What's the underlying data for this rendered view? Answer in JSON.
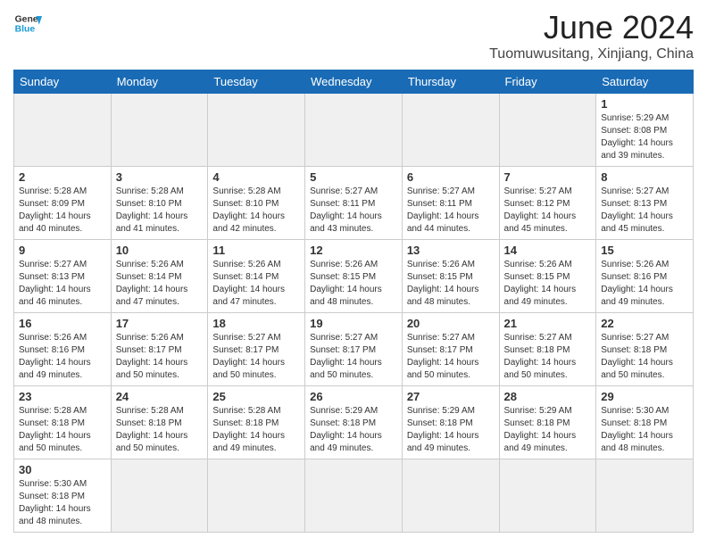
{
  "header": {
    "logo_general": "General",
    "logo_blue": "Blue",
    "month_title": "June 2024",
    "location": "Tuomuwusitang, Xinjiang, China"
  },
  "days_of_week": [
    "Sunday",
    "Monday",
    "Tuesday",
    "Wednesday",
    "Thursday",
    "Friday",
    "Saturday"
  ],
  "weeks": [
    [
      {
        "day": "",
        "empty": true
      },
      {
        "day": "",
        "empty": true
      },
      {
        "day": "",
        "empty": true
      },
      {
        "day": "",
        "empty": true
      },
      {
        "day": "",
        "empty": true
      },
      {
        "day": "",
        "empty": true
      },
      {
        "day": "1",
        "sunrise": "5:29 AM",
        "sunset": "8:08 PM",
        "daylight": "14 hours and 39 minutes."
      }
    ],
    [
      {
        "day": "2",
        "sunrise": "5:28 AM",
        "sunset": "8:09 PM",
        "daylight": "14 hours and 40 minutes."
      },
      {
        "day": "3",
        "sunrise": "5:28 AM",
        "sunset": "8:10 PM",
        "daylight": "14 hours and 41 minutes."
      },
      {
        "day": "4",
        "sunrise": "5:28 AM",
        "sunset": "8:10 PM",
        "daylight": "14 hours and 42 minutes."
      },
      {
        "day": "5",
        "sunrise": "5:27 AM",
        "sunset": "8:11 PM",
        "daylight": "14 hours and 43 minutes."
      },
      {
        "day": "6",
        "sunrise": "5:27 AM",
        "sunset": "8:11 PM",
        "daylight": "14 hours and 44 minutes."
      },
      {
        "day": "7",
        "sunrise": "5:27 AM",
        "sunset": "8:12 PM",
        "daylight": "14 hours and 45 minutes."
      },
      {
        "day": "8",
        "sunrise": "5:27 AM",
        "sunset": "8:13 PM",
        "daylight": "14 hours and 45 minutes."
      }
    ],
    [
      {
        "day": "9",
        "sunrise": "5:27 AM",
        "sunset": "8:13 PM",
        "daylight": "14 hours and 46 minutes."
      },
      {
        "day": "10",
        "sunrise": "5:26 AM",
        "sunset": "8:14 PM",
        "daylight": "14 hours and 47 minutes."
      },
      {
        "day": "11",
        "sunrise": "5:26 AM",
        "sunset": "8:14 PM",
        "daylight": "14 hours and 47 minutes."
      },
      {
        "day": "12",
        "sunrise": "5:26 AM",
        "sunset": "8:15 PM",
        "daylight": "14 hours and 48 minutes."
      },
      {
        "day": "13",
        "sunrise": "5:26 AM",
        "sunset": "8:15 PM",
        "daylight": "14 hours and 48 minutes."
      },
      {
        "day": "14",
        "sunrise": "5:26 AM",
        "sunset": "8:15 PM",
        "daylight": "14 hours and 49 minutes."
      },
      {
        "day": "15",
        "sunrise": "5:26 AM",
        "sunset": "8:16 PM",
        "daylight": "14 hours and 49 minutes."
      }
    ],
    [
      {
        "day": "16",
        "sunrise": "5:26 AM",
        "sunset": "8:16 PM",
        "daylight": "14 hours and 49 minutes."
      },
      {
        "day": "17",
        "sunrise": "5:26 AM",
        "sunset": "8:17 PM",
        "daylight": "14 hours and 50 minutes."
      },
      {
        "day": "18",
        "sunrise": "5:27 AM",
        "sunset": "8:17 PM",
        "daylight": "14 hours and 50 minutes."
      },
      {
        "day": "19",
        "sunrise": "5:27 AM",
        "sunset": "8:17 PM",
        "daylight": "14 hours and 50 minutes."
      },
      {
        "day": "20",
        "sunrise": "5:27 AM",
        "sunset": "8:17 PM",
        "daylight": "14 hours and 50 minutes."
      },
      {
        "day": "21",
        "sunrise": "5:27 AM",
        "sunset": "8:18 PM",
        "daylight": "14 hours and 50 minutes."
      },
      {
        "day": "22",
        "sunrise": "5:27 AM",
        "sunset": "8:18 PM",
        "daylight": "14 hours and 50 minutes."
      }
    ],
    [
      {
        "day": "23",
        "sunrise": "5:28 AM",
        "sunset": "8:18 PM",
        "daylight": "14 hours and 50 minutes."
      },
      {
        "day": "24",
        "sunrise": "5:28 AM",
        "sunset": "8:18 PM",
        "daylight": "14 hours and 50 minutes."
      },
      {
        "day": "25",
        "sunrise": "5:28 AM",
        "sunset": "8:18 PM",
        "daylight": "14 hours and 49 minutes."
      },
      {
        "day": "26",
        "sunrise": "5:29 AM",
        "sunset": "8:18 PM",
        "daylight": "14 hours and 49 minutes."
      },
      {
        "day": "27",
        "sunrise": "5:29 AM",
        "sunset": "8:18 PM",
        "daylight": "14 hours and 49 minutes."
      },
      {
        "day": "28",
        "sunrise": "5:29 AM",
        "sunset": "8:18 PM",
        "daylight": "14 hours and 49 minutes."
      },
      {
        "day": "29",
        "sunrise": "5:30 AM",
        "sunset": "8:18 PM",
        "daylight": "14 hours and 48 minutes."
      }
    ],
    [
      {
        "day": "30",
        "sunrise": "5:30 AM",
        "sunset": "8:18 PM",
        "daylight": "14 hours and 48 minutes."
      },
      {
        "day": "",
        "empty": true
      },
      {
        "day": "",
        "empty": true
      },
      {
        "day": "",
        "empty": true
      },
      {
        "day": "",
        "empty": true
      },
      {
        "day": "",
        "empty": true
      },
      {
        "day": "",
        "empty": true
      }
    ]
  ]
}
